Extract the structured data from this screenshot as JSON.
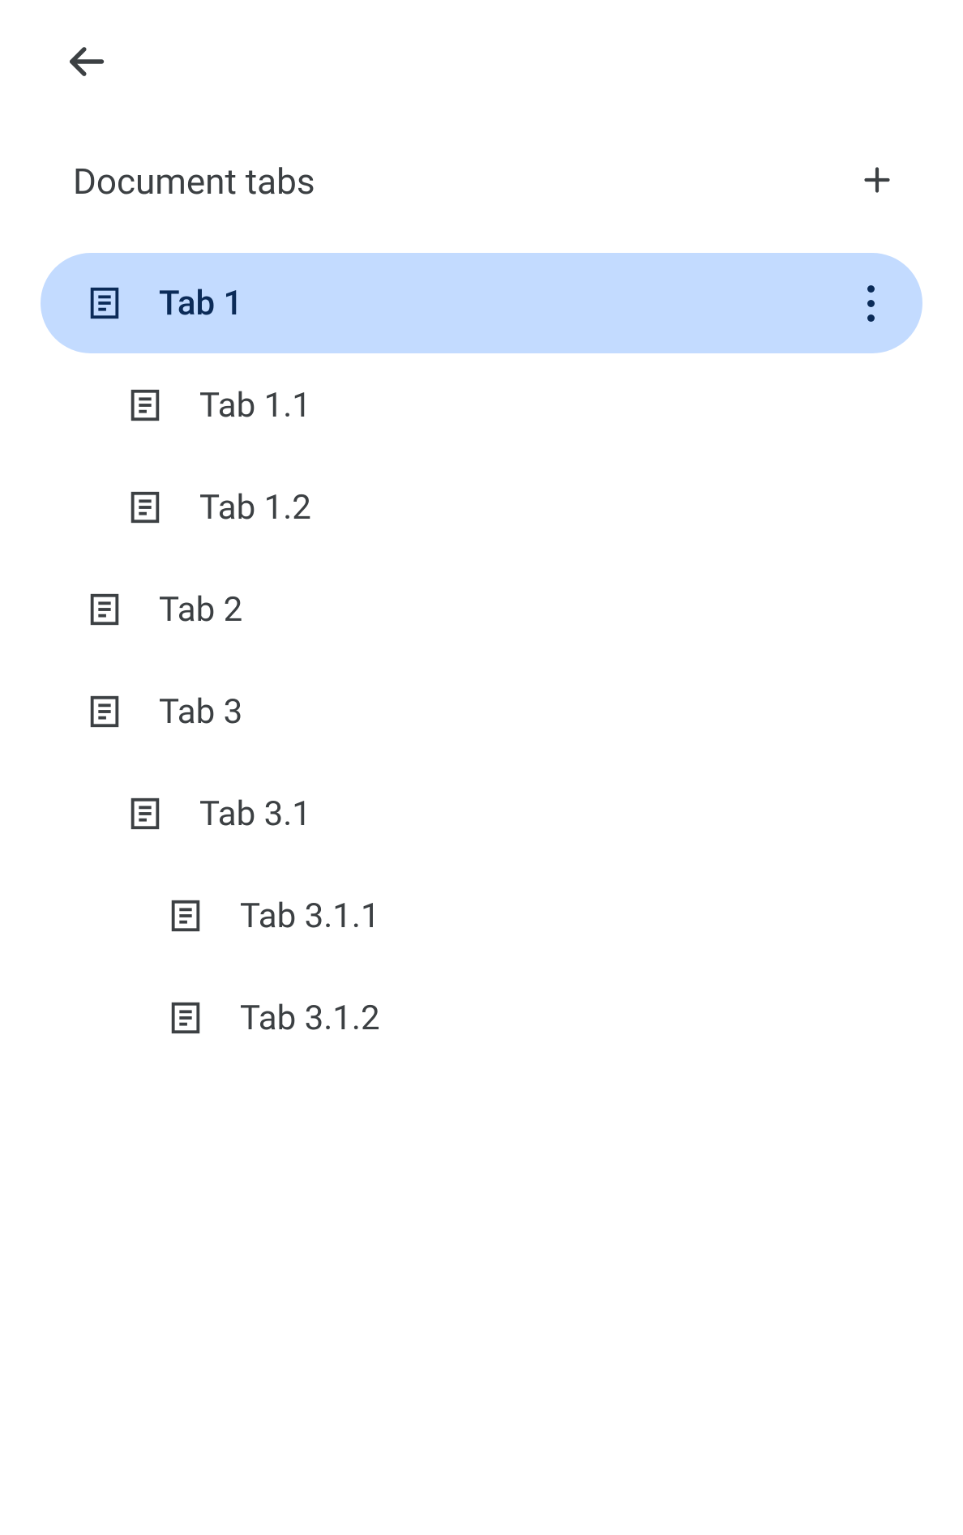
{
  "header": {
    "title": "Document tabs"
  },
  "tabs": [
    {
      "label": "Tab 1",
      "level": 0,
      "selected": true
    },
    {
      "label": "Tab 1.1",
      "level": 1,
      "selected": false
    },
    {
      "label": "Tab 1.2",
      "level": 1,
      "selected": false
    },
    {
      "label": "Tab 2",
      "level": 0,
      "selected": false
    },
    {
      "label": "Tab 3",
      "level": 0,
      "selected": false
    },
    {
      "label": "Tab 3.1",
      "level": 1,
      "selected": false
    },
    {
      "label": "Tab 3.1.1",
      "level": 2,
      "selected": false
    },
    {
      "label": "Tab 3.1.2",
      "level": 2,
      "selected": false
    }
  ],
  "colors": {
    "selected_bg": "#c3dbff",
    "selected_text": "#0b2b58",
    "text": "#3c4043"
  }
}
